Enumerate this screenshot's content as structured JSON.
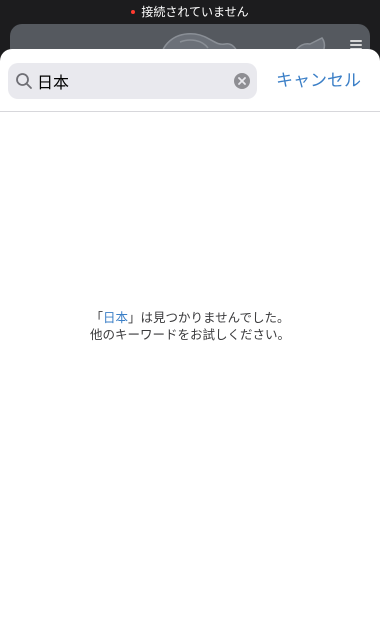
{
  "status": {
    "text": "接続されていません",
    "dot_color": "#ff3b30"
  },
  "search": {
    "value": "日本",
    "icon": "search-icon",
    "clear_icon": "clear-icon"
  },
  "cancel_label": "キャンセル",
  "empty_state": {
    "open_quote": "「",
    "query": "日本",
    "close_text": "」は見つかりませんでした。",
    "line2": "他のキーワードをお試しください。"
  },
  "colors": {
    "accent": "#3b7fc7",
    "sheet_bg": "#ffffff",
    "field_bg": "#e9e9ee",
    "backdrop": "#1c1c1e"
  }
}
